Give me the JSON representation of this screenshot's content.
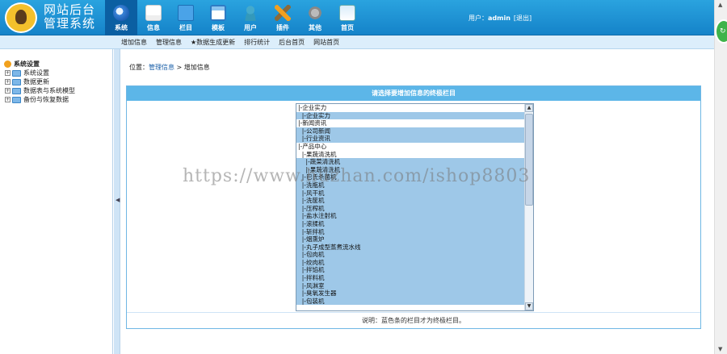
{
  "header": {
    "brand_line1": "网站后台",
    "brand_line2": "管理系统",
    "nav": [
      {
        "label": "系统",
        "icon": "system-globe-icon",
        "active": true
      },
      {
        "label": "信息",
        "icon": "edit-info-icon"
      },
      {
        "label": "栏目",
        "icon": "folder-column-icon"
      },
      {
        "label": "模板",
        "icon": "template-window-icon"
      },
      {
        "label": "用户",
        "icon": "user-icon"
      },
      {
        "label": "插件",
        "icon": "plugin-tools-icon"
      },
      {
        "label": "其他",
        "icon": "gear-other-icon"
      },
      {
        "label": "首页",
        "icon": "home-page-icon"
      }
    ],
    "user_prefix": "用户：",
    "username": "admin",
    "logout": "[退出]"
  },
  "subnav": [
    "增加信息",
    "管理信息",
    "★数据生成更新",
    "排行统计",
    "后台首页",
    "网站首页"
  ],
  "sidebar": {
    "root": "系统设置",
    "items": [
      "系统设置",
      "数据更新",
      "数据表与系统模型",
      "备份与恢复数据"
    ]
  },
  "breadcrumb": {
    "prefix": "位置：",
    "link": "管理信息",
    "sep": " > ",
    "current": "增加信息"
  },
  "panel": {
    "title": "请选择要增加信息的终极栏目",
    "footer": "说明：蓝色条的栏目才为终极栏目。",
    "options": [
      {
        "text": "|-企业实力",
        "kind": "normal"
      },
      {
        "text": "  |-企业实力",
        "kind": "leaf"
      },
      {
        "text": "|-新闻资讯",
        "kind": "normal"
      },
      {
        "text": "  |-公司新闻",
        "kind": "leaf"
      },
      {
        "text": "  |-行业资讯",
        "kind": "leaf"
      },
      {
        "text": "|-产品中心",
        "kind": "normal"
      },
      {
        "text": "  |-果蔬清洗机",
        "kind": "normal"
      },
      {
        "text": "    |-蔬菜清洗机",
        "kind": "leaf"
      },
      {
        "text": "    |-果蔬清洗机",
        "kind": "leaf"
      },
      {
        "text": "  |-巴氏杀菌机",
        "kind": "leaf"
      },
      {
        "text": "  |-洗瓶机",
        "kind": "leaf"
      },
      {
        "text": "  |-风干机",
        "kind": "leaf"
      },
      {
        "text": "  |-洗筐机",
        "kind": "leaf"
      },
      {
        "text": "  |-压榨机",
        "kind": "leaf"
      },
      {
        "text": "  |-盐水注射机",
        "kind": "leaf"
      },
      {
        "text": "  |-滚揉机",
        "kind": "leaf"
      },
      {
        "text": "  |-斩拌机",
        "kind": "leaf"
      },
      {
        "text": "  |-烟熏炉",
        "kind": "leaf"
      },
      {
        "text": "  |-丸子成型蒸煮流水线",
        "kind": "leaf"
      },
      {
        "text": "  |-包肉机",
        "kind": "leaf"
      },
      {
        "text": "  |-绞肉机",
        "kind": "leaf"
      },
      {
        "text": "  |-拌馅机",
        "kind": "leaf"
      },
      {
        "text": "  |-拌料机",
        "kind": "leaf"
      },
      {
        "text": "  |-风淋室",
        "kind": "leaf"
      },
      {
        "text": "  |-臭氧发生器",
        "kind": "leaf"
      },
      {
        "text": "  |-包装机",
        "kind": "leaf"
      }
    ]
  },
  "watermark": "https://www.huzhan.com/ishop8803",
  "colors": {
    "header": "#1a8fd3",
    "leaf_bar": "#9ec8e8",
    "panel_title": "#5cb6e8"
  }
}
